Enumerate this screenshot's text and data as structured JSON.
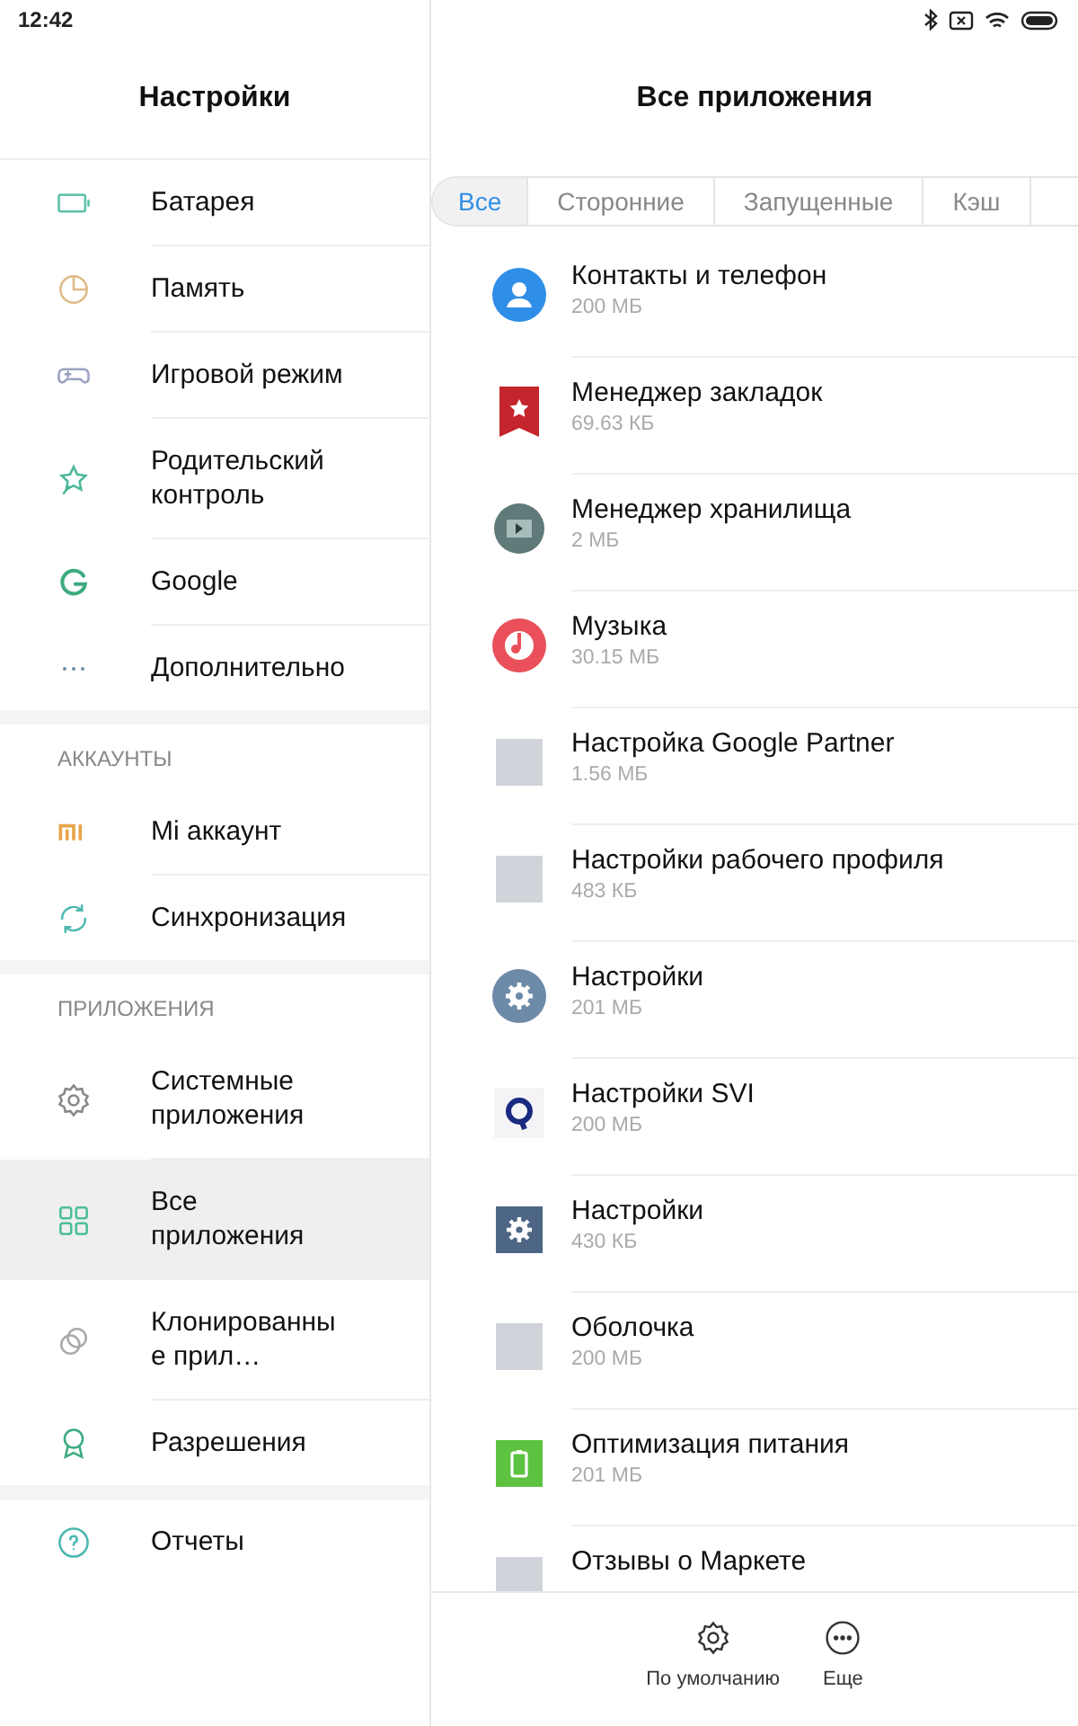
{
  "status_bar": {
    "time": "12:42"
  },
  "sidebar": {
    "title": "Настройки",
    "sections": [
      {
        "items": [
          {
            "label": "Батарея",
            "kind": "battery",
            "selected": false
          },
          {
            "label": "Память",
            "kind": "pie",
            "selected": false
          },
          {
            "label": "Игровой режим",
            "kind": "gamepad",
            "selected": false
          },
          {
            "label": "Родительский контроль",
            "kind": "star",
            "selected": false
          },
          {
            "label": "Google",
            "kind": "google",
            "selected": false
          },
          {
            "label": "Дополнительно",
            "kind": "dots",
            "selected": false
          }
        ]
      },
      {
        "header": "АККАУНТЫ",
        "items": [
          {
            "label": "Mi аккаунт",
            "kind": "mi",
            "selected": false
          },
          {
            "label": "Синхронизация",
            "kind": "sync",
            "selected": false
          }
        ]
      },
      {
        "header": "ПРИЛОЖЕНИЯ",
        "items": [
          {
            "label": "Системные приложения",
            "kind": "gear",
            "selected": false
          },
          {
            "label": "Все приложения",
            "kind": "grid",
            "selected": true
          },
          {
            "label": "Клонированные прил…",
            "kind": "clone",
            "selected": false
          },
          {
            "label": "Разрешения",
            "kind": "ribbon",
            "selected": false
          }
        ]
      },
      {
        "items": [
          {
            "label": "Отчеты",
            "kind": "help",
            "selected": false
          }
        ]
      }
    ]
  },
  "main": {
    "title": "Все приложения",
    "tabs": [
      {
        "label": "Все",
        "selected": true
      },
      {
        "label": "Сторонние",
        "selected": false
      },
      {
        "label": "Запущенные",
        "selected": false
      },
      {
        "label": "Кэш",
        "selected": false
      }
    ],
    "apps": [
      {
        "name": "Контакты и телефон",
        "size": "200 МБ",
        "kind": "contacts"
      },
      {
        "name": "Менеджер закладок",
        "size": "69.63 КБ",
        "kind": "bookmark"
      },
      {
        "name": "Менеджер хранилища",
        "size": "2 МБ",
        "kind": "storage"
      },
      {
        "name": "Музыка",
        "size": "30.15 МБ",
        "kind": "music"
      },
      {
        "name": "Настройка Google Partner",
        "size": "1.56 МБ",
        "kind": "blank"
      },
      {
        "name": "Настройки рабочего профиля",
        "size": "483 КБ",
        "kind": "blank"
      },
      {
        "name": "Настройки",
        "size": "201 МБ",
        "kind": "gear-round"
      },
      {
        "name": "Настройки SVI",
        "size": "200 МБ",
        "kind": "q"
      },
      {
        "name": "Настройки",
        "size": "430 КБ",
        "kind": "gear-square"
      },
      {
        "name": "Оболочка",
        "size": "200 МБ",
        "kind": "blank"
      },
      {
        "name": "Оптимизация питания",
        "size": "201 МБ",
        "kind": "power"
      },
      {
        "name": "Отзывы о Маркете",
        "kind": "blank"
      }
    ],
    "actions": [
      {
        "label": "По умолчанию",
        "kind": "gear"
      },
      {
        "label": "Еще",
        "kind": "more"
      }
    ]
  }
}
